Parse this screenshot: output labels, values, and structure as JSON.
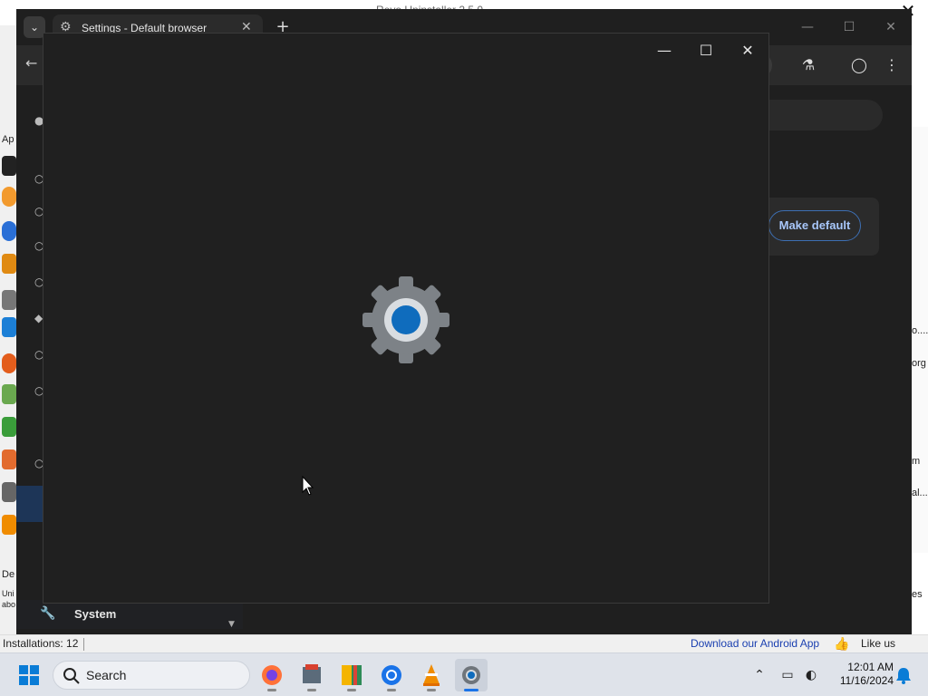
{
  "background_app": {
    "title": "Revo Uninstaller 2.5.0",
    "close_glyph": "✕",
    "left_labels": [
      "Ap",
      "De",
      "Uni",
      "abo"
    ],
    "right_labels": [
      "o....",
      "org",
      "m",
      "al...",
      "es"
    ],
    "status": {
      "installations": "Installations: 12",
      "android_link": "Download our Android App",
      "like": "Like us"
    }
  },
  "chrome": {
    "tab_title": "Settings - Default browser",
    "tab_close": "✕",
    "new_tab": "+",
    "make_default": "Make default",
    "system_label": "System"
  },
  "splash_window": {
    "minimize": "—",
    "maximize": "☐",
    "close": "✕",
    "gear_outer": "#7d8287",
    "gear_center": "#0f6cbd"
  },
  "taskbar": {
    "search_placeholder": "Search",
    "apps": [
      "firefox",
      "revo-uninstaller",
      "maps",
      "chrome",
      "vlc",
      "settings"
    ],
    "clock_time": "12:01 AM",
    "clock_date": "11/16/2024"
  }
}
